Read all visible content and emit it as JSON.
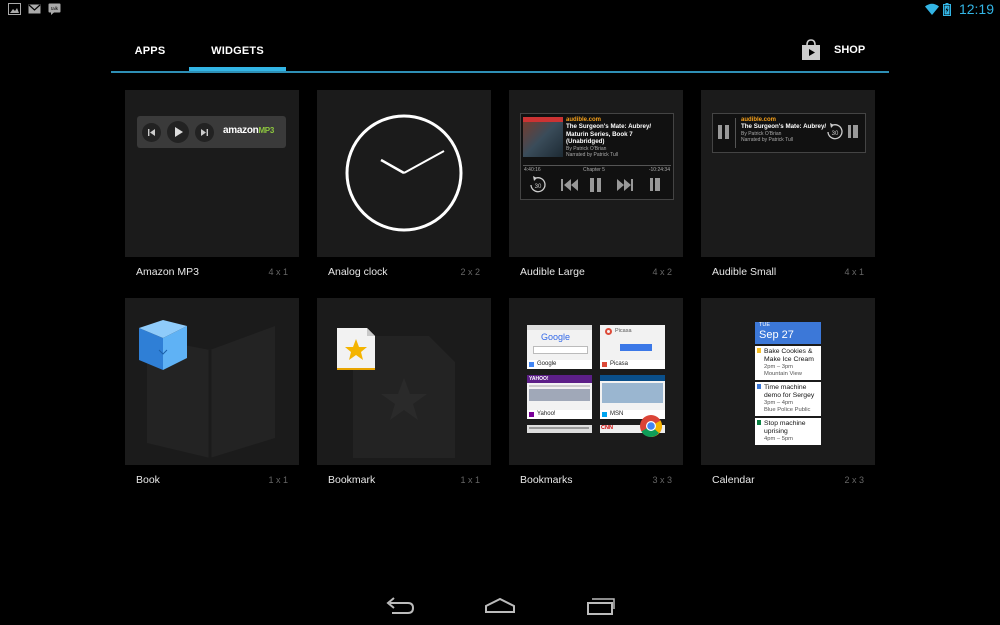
{
  "status_bar": {
    "left_icons": [
      "gallery-icon",
      "gmail-icon",
      "talk-icon"
    ],
    "right_icons": [
      "wifi-icon",
      "battery-icon"
    ],
    "time": "12:19",
    "accent": "#33b5e5"
  },
  "tabs": {
    "apps": "APPS",
    "widgets": "WIDGETS",
    "active": "widgets",
    "shop": "SHOP",
    "shop_icon": "play-store-icon"
  },
  "widgets": [
    {
      "name": "Amazon MP3",
      "size": "4 x 1",
      "preview": {
        "logo_main": "amazon",
        "logo_sub": "MP3"
      }
    },
    {
      "name": "Analog clock",
      "size": "2 x 2"
    },
    {
      "name": "Audible Large",
      "size": "4 x 2",
      "preview": {
        "site": "audible.com",
        "title_lines": [
          "The Surgeon's Mate: Aubrey/",
          "Maturin Series, Book 7",
          "(Unabridged)"
        ],
        "author": "By Patrick O'Brian",
        "narrator": "Narrated by Patrick Tull",
        "elapsed": "4:40:16",
        "chapter": "Chapter 5",
        "remaining": "-10:24:34",
        "skip": "30"
      }
    },
    {
      "name": "Audible Small",
      "size": "4 x 1",
      "preview": {
        "site": "audible.com",
        "title": "The Surgeon's Mate: Aubrey/",
        "author": "By Patrick O'Brian",
        "narrator": "Narrated by Patrick Tull",
        "skip": "30"
      }
    },
    {
      "name": "Book",
      "size": "1 x 1"
    },
    {
      "name": "Bookmark",
      "size": "1 x 1"
    },
    {
      "name": "Bookmarks",
      "size": "3 x 3",
      "preview": {
        "sites": [
          "Google",
          "Picasa",
          "Yahoo!",
          "MSN"
        ],
        "top_labels": [
          "Google",
          "Picasa",
          "YAHOO!",
          "CNN"
        ]
      }
    },
    {
      "name": "Calendar",
      "size": "2 x 3",
      "preview": {
        "dow": "TUE",
        "date": "Sep 27",
        "events": [
          {
            "title": "Bake Cookies & Make Ice Cream",
            "sub": "2pm – 3pm",
            "loc": "Mountain View"
          },
          {
            "title": "Time machine demo for Sergey",
            "sub": "3pm – 4pm",
            "loc": "Blue Police Public"
          },
          {
            "title": "Stop machine uprising",
            "sub": "4pm – 5pm",
            "loc": ""
          }
        ]
      }
    }
  ],
  "nav": {
    "back": "back-icon",
    "home": "home-icon",
    "recents": "recents-icon"
  },
  "colors": {
    "background": "#000000",
    "cell": "#1b1b1b",
    "accent": "#33b5e5"
  }
}
